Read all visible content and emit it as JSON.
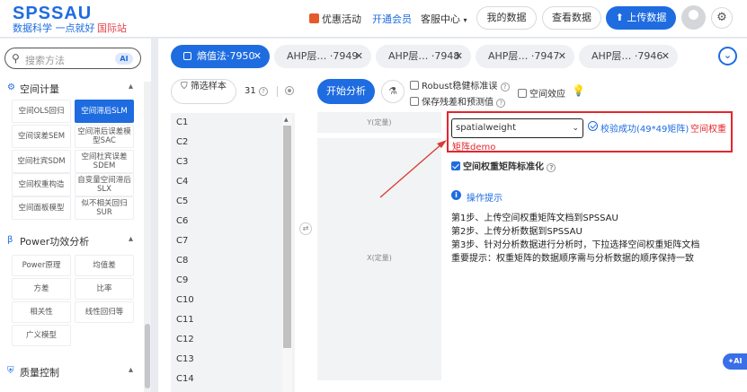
{
  "header": {
    "logo": "SPSSAU",
    "slogan": "数据科学 一点就好",
    "intl": "国际站",
    "promo": "优惠活动",
    "vip": "开通会员",
    "service": "客服中心",
    "my_data": "我的数据",
    "view_data": "查看数据",
    "upload": "上传数据"
  },
  "sidebar": {
    "search_placeholder": "搜索方法",
    "ai_badge": "AI",
    "section1": "空间计量",
    "items1": [
      "空间OLS回归",
      "空间滞后SLM",
      "空间误差SEM",
      "空间滞后误差模型SAC",
      "空间杜宾SDM",
      "空间杜宾误差SDEM",
      "空间权重构造",
      "自变量空间滞后SLX",
      "空间面板模型",
      "似不相关回归SUR"
    ],
    "section2": "Power功效分析",
    "items2": [
      "Power原理",
      "均值差",
      "方差",
      "比率",
      "相关性",
      "线性回归等",
      "广义模型"
    ],
    "section3": "质量控制"
  },
  "tabs": [
    {
      "label": "熵值法·7950"
    },
    {
      "label": "AHP层…  ·7949"
    },
    {
      "label": "AHP层…  ·7948"
    },
    {
      "label": "AHP层…  ·7947"
    },
    {
      "label": "AHP层…  ·7946"
    }
  ],
  "toolbar": {
    "filter_label": "筛选样本",
    "count": "31",
    "run_label": "开始分析",
    "robust_label": "Robust稳健标准误",
    "save_label": "保存残差和预测值",
    "effect_label": "空间效应"
  },
  "variables": [
    "C1",
    "C2",
    "C3",
    "C4",
    "C5",
    "C6",
    "C7",
    "C8",
    "C9",
    "C10",
    "C11",
    "C12",
    "C13",
    "C14"
  ],
  "boxes": {
    "y_label": "Y(定量)",
    "x_label": "X(定量)"
  },
  "panel": {
    "select_value": "spatialweight",
    "verify_ok": "校验成功(49*49矩阵)",
    "matrix_label": "空间权重",
    "matrix_demo": "矩阵demo",
    "standardize": "空间权重矩阵标准化",
    "tips_title": "操作提示",
    "steps": [
      "第1步、上传空间权重矩阵文档到SPSSAU",
      "第2步、上传分析数据到SPSSAU",
      "第3步、针对分析数据进行分析时，下拉选择空间权重矩阵文档",
      "重要提示：权重矩阵的数据顺序需与分析数据的顺序保持一致"
    ]
  },
  "ai_fab": "AI",
  "colors": {
    "primary": "#1e6ce0",
    "alert": "#e3262d"
  }
}
